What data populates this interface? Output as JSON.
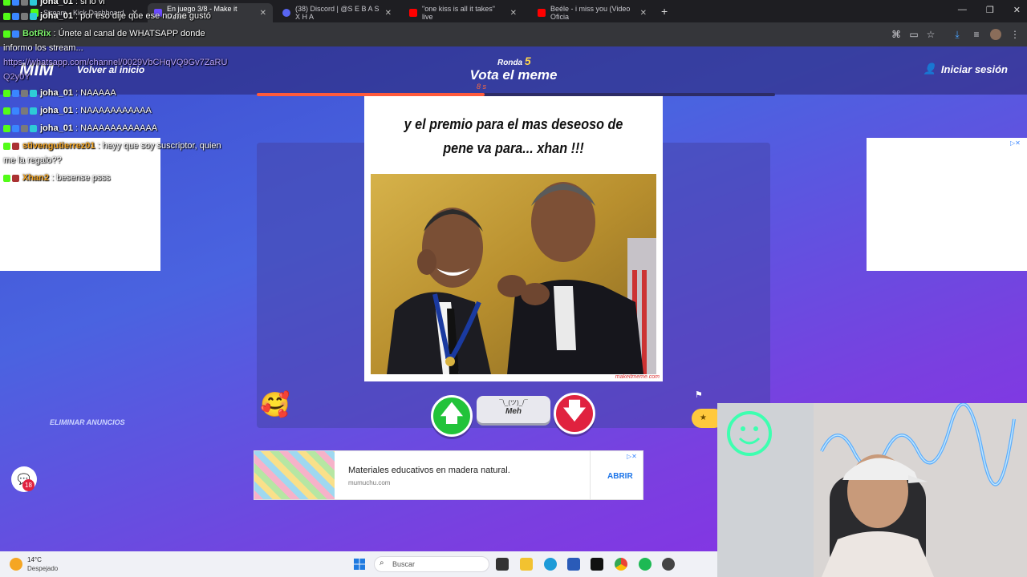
{
  "browser": {
    "tabs": [
      {
        "title": "Stream - Kick Dashboard",
        "active": false,
        "color": "#53fc18"
      },
      {
        "title": "En juego 3/8 - Make it Meme",
        "active": true,
        "color": "#6b4bff"
      },
      {
        "title": "(38) Discord | @S E B A S X H A",
        "active": false,
        "color": "#5865f2"
      },
      {
        "title": "\"one kiss is all it takes\" live",
        "active": false,
        "color": "#ff0000"
      },
      {
        "title": "Beéle - i miss you (Video Oficia",
        "active": false,
        "color": "#ff0000"
      }
    ],
    "new_tab": "+"
  },
  "site": {
    "logo": "MIM",
    "back_link": "Volver al inicio",
    "round_label": "Ronda",
    "round_number": "5",
    "vote_title": "Vota el meme",
    "timer": "8 s",
    "timer_progress": 0.44,
    "login": "Iniciar sesión"
  },
  "meme": {
    "caption": "y el premio para el mas deseoso de pene va para... xhan !!!",
    "watermark": "makeitmeme.com"
  },
  "vote": {
    "meh_face": "¯\\_(ツ)_/¯",
    "meh_label": "Meh",
    "up_icon": "arrow-up",
    "down_icon": "arrow-down"
  },
  "remove_ads": "ELIMINAR ANUNCIOS",
  "chat_badge_count": "18",
  "bottom_ad": {
    "title": "Materiales educativos en madera natural.",
    "domain": "mumuchu.com",
    "cta": "ABRIR"
  },
  "chat": [
    {
      "user": "joha_01",
      "text": ": si lo vi",
      "color": "#ffffff"
    },
    {
      "user": "joha_01",
      "text": ": por eso dije que ese no me gustó",
      "color": "#ffffff"
    },
    {
      "user": "BotRix",
      "text": ": Únete al canal de WHATSAPP donde",
      "color": "#7cf26b"
    },
    {
      "user": "",
      "text": "informo los stream...",
      "color": "#ffffff"
    },
    {
      "user": "",
      "text": "https://whatsapp.com/channel/0029VbCHqVQ9Gv7ZaRU",
      "color": "#b9a3ff"
    },
    {
      "user": "",
      "text": "Q2y0Y",
      "color": "#b9a3ff"
    },
    {
      "user": "joha_01",
      "text": ": NAAAAA",
      "color": "#ffffff"
    },
    {
      "user": "joha_01",
      "text": ": NAAAAAAAAAAA",
      "color": "#ffffff"
    },
    {
      "user": "joha_01",
      "text": ": NAAAAAAAAAAAA",
      "color": "#ffffff"
    },
    {
      "user": "stivengutierrez01",
      "text": ": heyy que soy suscriptor, quien",
      "color": "#f5a623"
    },
    {
      "user": "",
      "text": "me la regalo??",
      "color": "#ffffff"
    },
    {
      "user": "Xhan2",
      "text": ": besense psss",
      "color": "#f5a623"
    }
  ],
  "taskbar": {
    "temp": "14°C",
    "weather": "Despejado",
    "search": "Buscar"
  }
}
